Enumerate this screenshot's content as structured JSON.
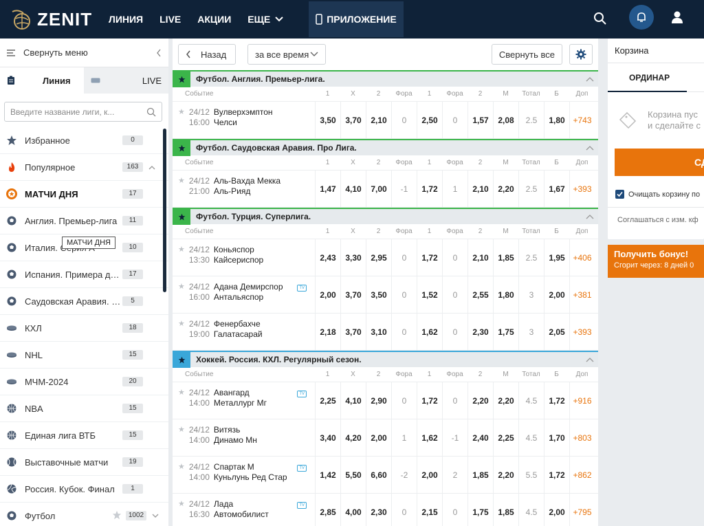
{
  "header": {
    "brand": "ZENIT",
    "nav": [
      "ЛИНИЯ",
      "LIVE",
      "АКЦИИ",
      "ЕЩЕ"
    ],
    "app_label": "ПРИЛОЖЕНИЕ"
  },
  "sidebar": {
    "collapse_label": "Свернуть меню",
    "tab_line": "Линия",
    "tab_live": "LIVE",
    "search_placeholder": "Введите название лиги, к...",
    "tooltip": "МАТЧИ ДНЯ",
    "items": [
      {
        "label": "Избранное",
        "count": "0",
        "icon": "star-icon"
      },
      {
        "label": "Популярное",
        "count": "163",
        "icon": "fire-icon"
      },
      {
        "label": "МАТЧИ ДНЯ",
        "count": "17",
        "icon": "match-of-day-icon"
      },
      {
        "label": "Англия. Премьер-лига",
        "count": "11",
        "icon": "football-icon"
      },
      {
        "label": "Италия. Серия А",
        "count": "10",
        "icon": "football-icon"
      },
      {
        "label": "Испания. Примера див...",
        "count": "17",
        "icon": "football-icon"
      },
      {
        "label": "Саудовская Аравия. П...",
        "count": "5",
        "icon": "football-icon"
      },
      {
        "label": "КХЛ",
        "count": "18",
        "icon": "hockey-puck-icon"
      },
      {
        "label": "NHL",
        "count": "15",
        "icon": "hockey-puck-icon"
      },
      {
        "label": "МЧМ-2024",
        "count": "20",
        "icon": "hockey-puck-icon"
      },
      {
        "label": "NBA",
        "count": "15",
        "icon": "basketball-icon"
      },
      {
        "label": "Единая лига ВТБ",
        "count": "15",
        "icon": "basketball-icon"
      },
      {
        "label": "Выставочные матчи",
        "count": "19",
        "icon": "tennis-ball-icon"
      },
      {
        "label": "Россия. Кубок. Финал",
        "count": "1",
        "icon": "volleyball-icon"
      },
      {
        "label": "Футбол",
        "count": "1002",
        "icon": "football-icon"
      }
    ]
  },
  "main": {
    "back_label": "Назад",
    "period_label": "за все время",
    "collapse_all_label": "Свернуть все",
    "columns": [
      "Событие",
      "1",
      "X",
      "2",
      "Фора",
      "1",
      "Фора",
      "2",
      "М",
      "Тотал",
      "Б",
      "Доп"
    ],
    "leagues": [
      {
        "title": "Футбол. Англия. Премьер-лига.",
        "sport": "football",
        "events": [
          {
            "date": "24/12",
            "time": "16:00",
            "team1": "Вулверхэмптон",
            "team2": "Челси",
            "tv": false,
            "odds": [
              "3,50",
              "3,70",
              "2,10",
              "0",
              "2,50",
              "0",
              "1,57",
              "2,08",
              "2.5",
              "1,80",
              "+743"
            ]
          }
        ]
      },
      {
        "title": "Футбол. Саудовская Аравия. Про Лига.",
        "sport": "football",
        "events": [
          {
            "date": "24/12",
            "time": "21:00",
            "team1": "Аль-Вахда Мекка",
            "team2": "Аль-Рияд",
            "tv": false,
            "odds": [
              "1,47",
              "4,10",
              "7,00",
              "-1",
              "1,72",
              "1",
              "2,10",
              "2,20",
              "2.5",
              "1,67",
              "+393"
            ]
          }
        ]
      },
      {
        "title": "Футбол. Турция. Суперлига.",
        "sport": "football",
        "events": [
          {
            "date": "24/12",
            "time": "13:30",
            "team1": "Коньяспор",
            "team2": "Кайсериспор",
            "tv": false,
            "odds": [
              "2,43",
              "3,30",
              "2,95",
              "0",
              "1,72",
              "0",
              "2,10",
              "1,85",
              "2.5",
              "1,95",
              "+406"
            ]
          },
          {
            "date": "24/12",
            "time": "16:00",
            "team1": "Адана Демирспор",
            "team2": "Антальяспор",
            "tv": true,
            "odds": [
              "2,00",
              "3,70",
              "3,50",
              "0",
              "1,52",
              "0",
              "2,55",
              "1,80",
              "3",
              "2,00",
              "+381"
            ]
          },
          {
            "date": "24/12",
            "time": "19:00",
            "team1": "Фенербахче",
            "team2": "Галатасарай",
            "tv": false,
            "odds": [
              "2,18",
              "3,70",
              "3,10",
              "0",
              "1,62",
              "0",
              "2,30",
              "1,75",
              "3",
              "2,05",
              "+393"
            ]
          }
        ]
      },
      {
        "title": "Хоккей. Россия. КХЛ. Регулярный сезон.",
        "sport": "hockey",
        "events": [
          {
            "date": "24/12",
            "time": "14:00",
            "team1": "Авангард",
            "team2": "Металлург Мг",
            "tv": true,
            "odds": [
              "2,25",
              "4,10",
              "2,90",
              "0",
              "1,72",
              "0",
              "2,20",
              "2,20",
              "4.5",
              "1,72",
              "+916"
            ]
          },
          {
            "date": "24/12",
            "time": "14:00",
            "team1": "Витязь",
            "team2": "Динамо Мн",
            "tv": false,
            "odds": [
              "3,40",
              "4,20",
              "2,00",
              "1",
              "1,62",
              "-1",
              "2,40",
              "2,25",
              "4.5",
              "1,70",
              "+803"
            ]
          },
          {
            "date": "24/12",
            "time": "14:00",
            "team1": "Спартак М",
            "team2": "Куньлунь Ред Стар",
            "tv": true,
            "odds": [
              "1,42",
              "5,50",
              "6,60",
              "-2",
              "2,00",
              "2",
              "1,85",
              "2,20",
              "5.5",
              "1,72",
              "+862"
            ]
          },
          {
            "date": "24/12",
            "time": "16:30",
            "team1": "Лада",
            "team2": "Автомобилист",
            "tv": true,
            "odds": [
              "2,85",
              "4,00",
              "2,30",
              "0",
              "2,15",
              "0",
              "1,75",
              "1,85",
              "4.5",
              "2,00",
              "+795"
            ]
          }
        ]
      }
    ]
  },
  "cart": {
    "title": "Корзина",
    "tab": "ОРДИНАР",
    "empty_text_1": "Корзина пус",
    "empty_text_2": "и сделайте с",
    "button": "СДЕ",
    "clear_label": "Очищать корзину по",
    "agree_label": "Соглашаться с изм. кф"
  },
  "bonus": {
    "title": "Получить бонус!",
    "subtitle": "Сгорит через: 8 дней 0"
  },
  "colors": {
    "header": "#0f2238",
    "accent": "#e8740c",
    "football": "#3bb54a",
    "hockey": "#3aa7d9"
  }
}
